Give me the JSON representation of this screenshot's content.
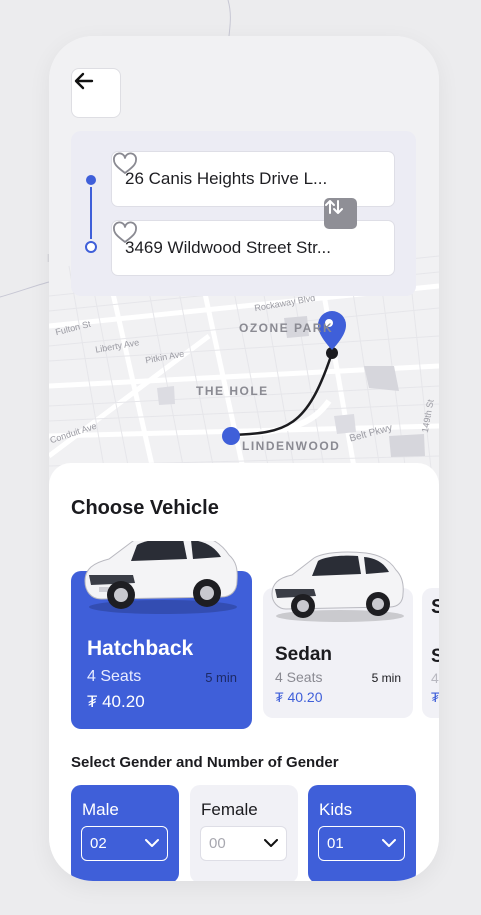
{
  "route": {
    "from": "26 Canis Heights Drive L...",
    "to": "3469 Wildwood Street Str..."
  },
  "map": {
    "areas": [
      "OZONE PARK",
      "THE HOLE",
      "LINDENWOOD"
    ],
    "streets": [
      "Fulton St",
      "Liberty Ave",
      "Pitkin Ave",
      "Belt Pkwy",
      "Conduit Ave",
      "149th St",
      "Rockaway Blvd"
    ]
  },
  "icons": {
    "back": "arrow-left-icon",
    "favorite": "heart-icon",
    "swap": "swap-vertical-icon",
    "destination": "map-pin-icon",
    "dropdown": "chevron-down-icon"
  },
  "vehicles": {
    "title": "Choose Vehicle",
    "items": [
      {
        "name": "Hatchback",
        "seats": "4 Seats",
        "time": "5 min",
        "price": "₮ 40.20",
        "selected": true
      },
      {
        "name": "Sedan",
        "seats": "4 Seats",
        "time": "5 min",
        "price": "₮ 40.20",
        "selected": false
      }
    ]
  },
  "gender": {
    "title": "Select Gender and Number of Gender",
    "options": [
      {
        "label": "Male",
        "value": "02",
        "selected": true
      },
      {
        "label": "Female",
        "value": "00",
        "selected": false
      },
      {
        "label": "Kids",
        "value": "01",
        "selected": true
      }
    ]
  },
  "colors": {
    "accent": "#3f5fd9",
    "card_bg": "#f1f1f6",
    "background": "#ececee"
  }
}
